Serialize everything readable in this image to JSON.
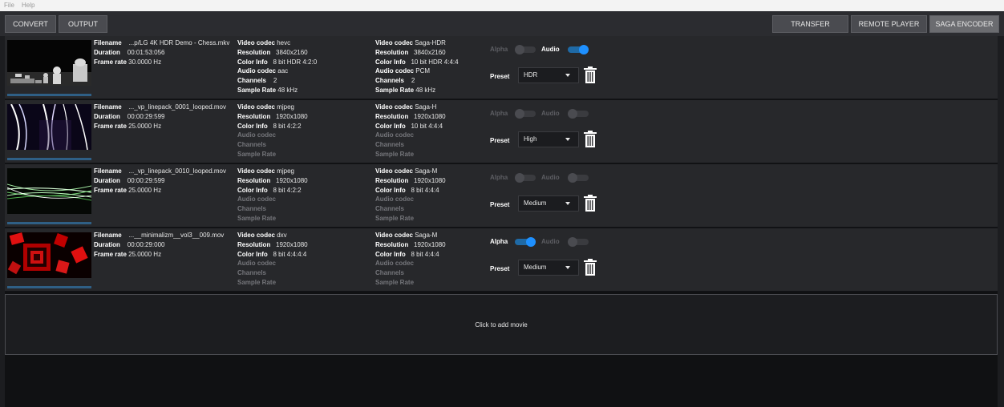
{
  "menu": {
    "file": "File",
    "help": "Help"
  },
  "toolbar": {
    "convert": "CONVERT",
    "output": "OUTPUT",
    "transfer": "TRANSFER",
    "remote_player": "REMOTE PLAYER",
    "saga_encoder": "SAGA ENCODER"
  },
  "labels": {
    "filename": "Filename",
    "duration": "Duration",
    "frame_rate": "Frame rate",
    "video_codec": "Video codec",
    "resolution": "Resolution",
    "color_info": "Color Info",
    "audio_codec": "Audio codec",
    "channels": "Channels",
    "sample_rate": "Sample Rate",
    "alpha": "Alpha",
    "audio": "Audio",
    "preset": "Preset"
  },
  "accent_color": "#1e90ff",
  "movies": [
    {
      "filename": "...p/LG 4K HDR Demo - Chess.mkv",
      "duration": "00:01:53:056",
      "frame_rate": "30.0000 Hz",
      "source": {
        "video_codec": "hevc",
        "resolution": "3840x2160",
        "color_info": "8 bit HDR 4:2:0",
        "audio_codec": "aac",
        "channels": "2",
        "sample_rate": "48 kHz"
      },
      "target": {
        "video_codec": "Saga-HDR",
        "resolution": "3840x2160",
        "color_info": "10 bit HDR 4:4:4",
        "audio_codec": "PCM",
        "channels": "2",
        "sample_rate": "48 kHz"
      },
      "alpha_on": false,
      "audio_on": true,
      "alpha_enabled": false,
      "audio_enabled": true,
      "preset": "HDR"
    },
    {
      "filename": "..._vp_linepack_0001_looped.mov",
      "duration": "00:00:29:599",
      "frame_rate": "25.0000 Hz",
      "source": {
        "video_codec": "mjpeg",
        "resolution": "1920x1080",
        "color_info": "8 bit 4:2:2",
        "audio_codec": "",
        "channels": "",
        "sample_rate": ""
      },
      "target": {
        "video_codec": "Saga-H",
        "resolution": "1920x1080",
        "color_info": "10 bit 4:4:4",
        "audio_codec": "",
        "channels": "",
        "sample_rate": ""
      },
      "alpha_on": false,
      "audio_on": false,
      "alpha_enabled": false,
      "audio_enabled": false,
      "preset": "High"
    },
    {
      "filename": "..._vp_linepack_0010_looped.mov",
      "duration": "00:00:29:599",
      "frame_rate": "25.0000 Hz",
      "source": {
        "video_codec": "mjpeg",
        "resolution": "1920x1080",
        "color_info": "8 bit 4:2:2",
        "audio_codec": "",
        "channels": "",
        "sample_rate": ""
      },
      "target": {
        "video_codec": "Saga-M",
        "resolution": "1920x1080",
        "color_info": "8 bit 4:4:4",
        "audio_codec": "",
        "channels": "",
        "sample_rate": ""
      },
      "alpha_on": false,
      "audio_on": false,
      "alpha_enabled": false,
      "audio_enabled": false,
      "preset": "Medium"
    },
    {
      "filename": "...__minimalizm__vol3__009.mov",
      "duration": "00:00:29:000",
      "frame_rate": "25.0000 Hz",
      "source": {
        "video_codec": "dxv",
        "resolution": "1920x1080",
        "color_info": "8 bit 4:4:4:4",
        "audio_codec": "",
        "channels": "",
        "sample_rate": ""
      },
      "target": {
        "video_codec": "Saga-M",
        "resolution": "1920x1080",
        "color_info": "8 bit 4:4:4",
        "audio_codec": "",
        "channels": "",
        "sample_rate": ""
      },
      "alpha_on": true,
      "audio_on": false,
      "alpha_enabled": true,
      "audio_enabled": false,
      "preset": "Medium"
    }
  ],
  "add_movie": "Click to add movie"
}
